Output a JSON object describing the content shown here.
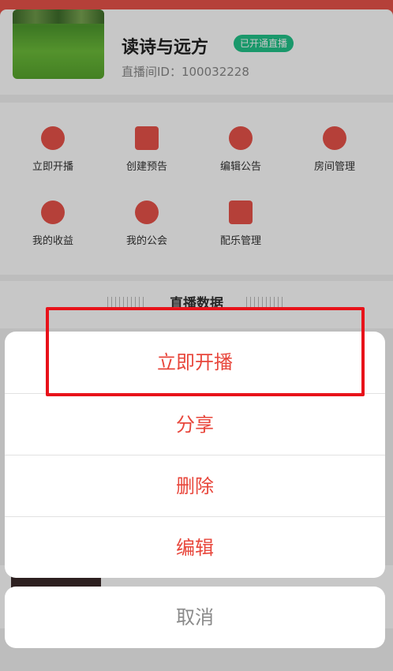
{
  "profile": {
    "channel_name": "读诗与远方",
    "badge": "已开通直播",
    "room_id": "直播间ID：100032228"
  },
  "menu": {
    "items": [
      {
        "label": "立即开播",
        "icon": "microphone-icon"
      },
      {
        "label": "创建预告",
        "icon": "calendar-icon"
      },
      {
        "label": "编辑公告",
        "icon": "megaphone-icon"
      },
      {
        "label": "房间管理",
        "icon": "manager-icon"
      },
      {
        "label": "我的收益",
        "icon": "pie-chart-icon"
      },
      {
        "label": "我的公会",
        "icon": "group-icon"
      },
      {
        "label": "配乐管理",
        "icon": "music-icon"
      }
    ]
  },
  "stats": {
    "title": "直播数据"
  },
  "action_sheet": {
    "items": [
      "立即开播",
      "分享",
      "删除",
      "编辑"
    ],
    "cancel": "取消"
  },
  "colors": {
    "accent": "#e8463b",
    "badge": "#22c389"
  }
}
